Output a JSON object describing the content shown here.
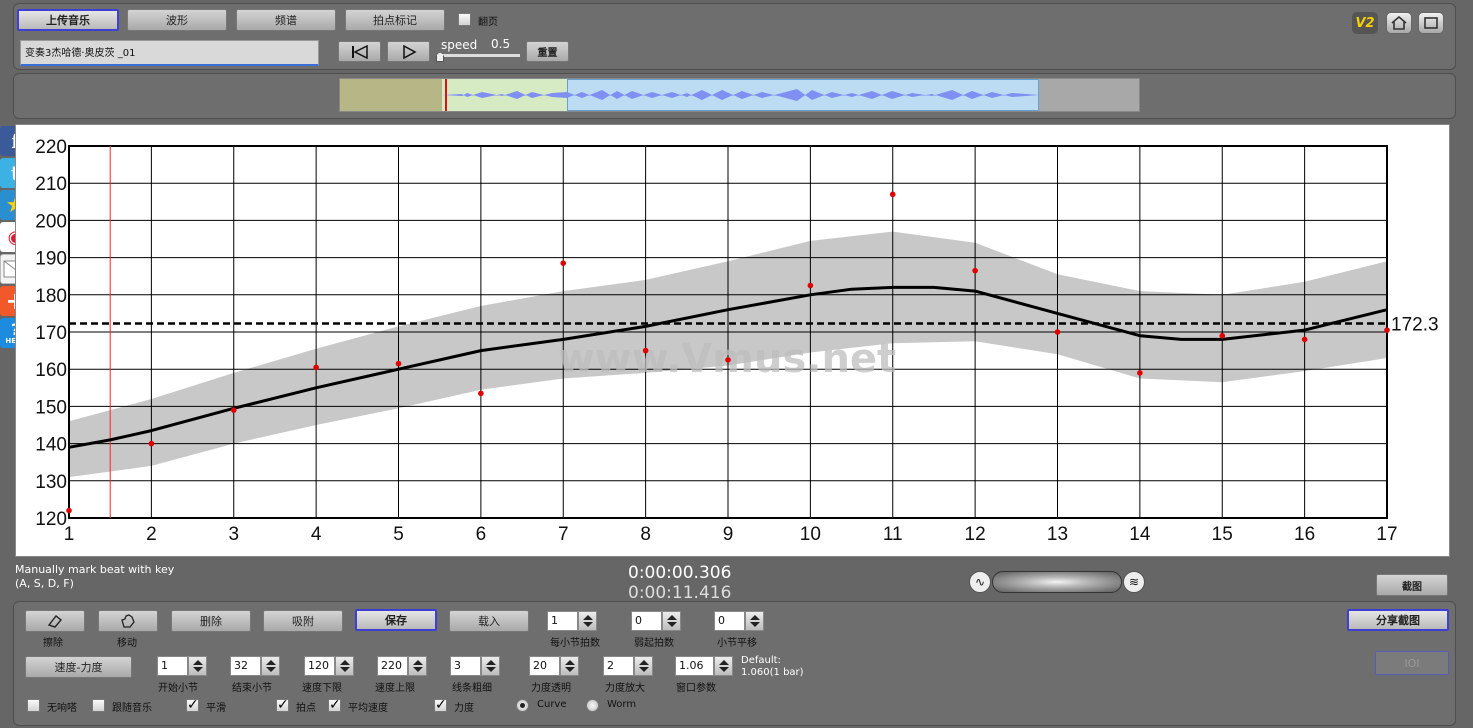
{
  "toolbar": {
    "upload_music": "上传音乐",
    "waveform": "波形",
    "spectrum": "频谱",
    "tap_mark": "拍点标记",
    "page_turn": "翻页",
    "page_turn_checked": false,
    "track_name": "变奏3杰哈德·奥皮茨 _01",
    "speed_label": "speed",
    "speed_value": "0.5",
    "reset": "重置"
  },
  "top_icons": {
    "version": "V2",
    "home": "home-icon",
    "fullscreen": "fullscreen-icon"
  },
  "social": [
    "facebook-icon",
    "twitter-icon",
    "favorite-star-icon",
    "weibo-icon",
    "mail-icon",
    "share-plus-icon",
    "help-icon"
  ],
  "social_help_text": "HELP",
  "graph": {
    "watermark": "www.Vmus.net",
    "mean_label": "172.3",
    "colors": {
      "curve": "#000000",
      "band": "#c8c8c8",
      "points": "#e00000",
      "cursor": "#ff2020"
    }
  },
  "chart_data": {
    "type": "line",
    "xlim": [
      1,
      17
    ],
    "ylim": [
      120,
      220
    ],
    "xticks": [
      "1",
      "2",
      "3",
      "4",
      "5",
      "6",
      "7",
      "8",
      "9",
      "10",
      "11",
      "12",
      "13",
      "14",
      "15",
      "16",
      "17"
    ],
    "yticks": [
      "120",
      "130",
      "140",
      "150",
      "160",
      "170",
      "180",
      "190",
      "200",
      "210",
      "220"
    ],
    "grid": true,
    "mean": 172.3,
    "cursor_x": 1.5,
    "points": {
      "x": [
        1.0,
        2.0,
        3.0,
        4.0,
        5.0,
        6.0,
        7.0,
        8.0,
        9.0,
        10.0,
        11.0,
        12.0,
        13.0,
        14.0,
        15.0,
        16.0,
        17.0
      ],
      "y": [
        122,
        140,
        149,
        160.5,
        161.5,
        153.5,
        188.5,
        165,
        162.5,
        182.5,
        207,
        186.5,
        170,
        159,
        169,
        168,
        170.5
      ]
    },
    "curve": {
      "x": [
        1,
        1.5,
        2,
        3,
        4,
        5,
        6,
        7,
        8,
        9,
        10,
        10.5,
        11,
        11.5,
        12,
        13,
        14,
        14.5,
        15,
        16,
        17
      ],
      "y": [
        139,
        141,
        143.5,
        149.5,
        155,
        160,
        165,
        168,
        171.5,
        176,
        180,
        181.5,
        182,
        182,
        181,
        175,
        169,
        168,
        168,
        170.5,
        176
      ]
    },
    "band_upper": {
      "x": [
        1,
        2,
        3,
        4,
        5,
        6,
        7,
        8,
        9,
        10,
        11,
        12,
        13,
        14,
        15,
        16,
        17
      ],
      "y": [
        146,
        152,
        159,
        165.5,
        171.5,
        177,
        181,
        184,
        189,
        194.5,
        197,
        194,
        185.5,
        181,
        180,
        183.5,
        189
      ]
    },
    "band_lower": {
      "x": [
        1,
        2,
        3,
        4,
        5,
        6,
        7,
        8,
        9,
        10,
        11,
        12,
        13,
        14,
        15,
        16,
        17
      ],
      "y": [
        131,
        134,
        140,
        145,
        149.5,
        154.5,
        157.5,
        159,
        161,
        164.5,
        167,
        167.5,
        164,
        157.5,
        156.5,
        159.5,
        163
      ]
    }
  },
  "status": {
    "hint_line1": "Manually mark beat with key",
    "hint_line2": "(A, S, D, F)",
    "time_current": "0:00:00.306",
    "time_total": "0:00:11.416",
    "screenshot": "截图"
  },
  "controls": {
    "erase": "擦除",
    "move": "移动",
    "delete": "删除",
    "snap": "吸附",
    "save": "保存",
    "load": "载入",
    "beats_per_bar": {
      "value": "1",
      "label": "每小节拍数"
    },
    "weak_beats": {
      "value": "0",
      "label": "弱起拍数"
    },
    "bar_shift": {
      "value": "0",
      "label": "小节平移"
    },
    "share_screenshot": "分享截图",
    "tempo_dynamics": "速度-力度",
    "start_bar": {
      "value": "1",
      "label": "开始小节"
    },
    "end_bar": {
      "value": "32",
      "label": "结束小节"
    },
    "tempo_min": {
      "value": "120",
      "label": "速度下限"
    },
    "tempo_max": {
      "value": "220",
      "label": "速度上限"
    },
    "line_width": {
      "value": "3",
      "label": "线条粗细"
    },
    "dyn_opacity": {
      "value": "20",
      "label": "力度透明"
    },
    "dyn_scale": {
      "value": "2",
      "label": "力度放大"
    },
    "window_param": {
      "value": "1.06",
      "label": "窗口参数"
    },
    "default_line1": "Default:",
    "default_line2": "1.060(1 bar)",
    "ioi": "IOI",
    "no_sound": {
      "label": "无响嗒",
      "checked": false
    },
    "follow_music": {
      "label": "跟随音乐",
      "checked": false
    },
    "smooth": {
      "label": "平滑",
      "checked": true
    },
    "beat_points": {
      "label": "拍点",
      "checked": true
    },
    "avg_tempo": {
      "label": "平均速度",
      "checked": true
    },
    "dynamics": {
      "label": "力度",
      "checked": true
    },
    "curve_mode": "Curve",
    "worm_mode": "Worm",
    "mode_selected": "Curve"
  }
}
